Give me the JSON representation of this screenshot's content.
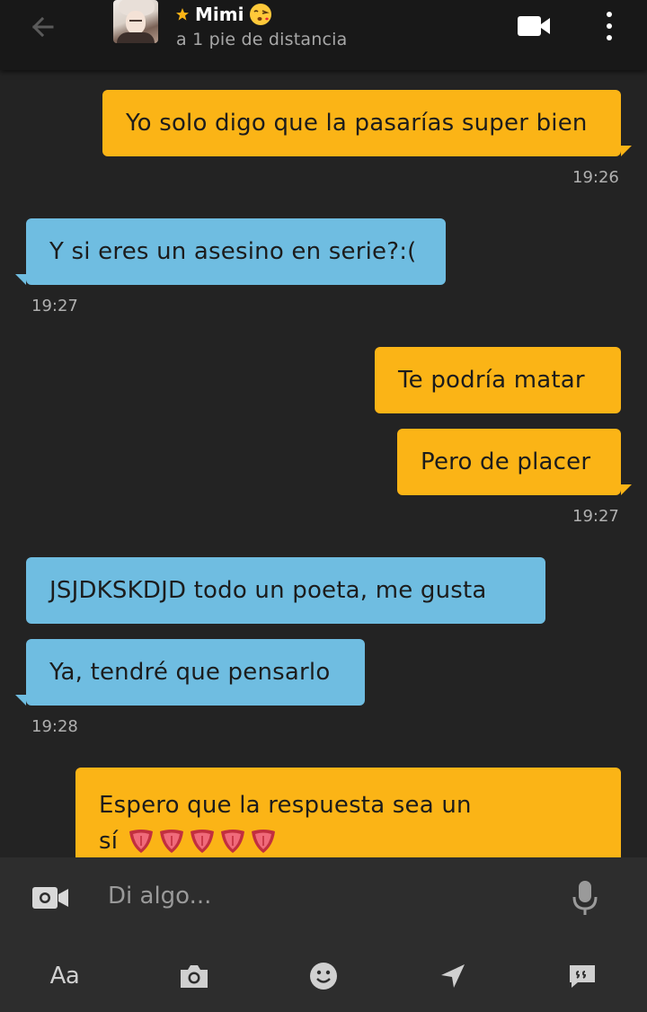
{
  "header": {
    "name": "Mimi",
    "distance": "a 1 pie de distancia",
    "icons": {
      "back": "back-arrow-icon",
      "favorite": "star-icon",
      "status_emoji": "kissing-face-emoji",
      "video": "video-camera-icon",
      "menu": "more-vertical-icon"
    },
    "colors": {
      "star": "#fbb416"
    }
  },
  "messages": [
    {
      "direction": "outgoing",
      "text": "Yo solo digo que la pasarías super bien"
    },
    {
      "direction": "outgoing",
      "time": "19:26"
    },
    {
      "direction": "incoming",
      "text": "Y si eres un asesino en serie?:("
    },
    {
      "direction": "incoming",
      "time": "19:27"
    },
    {
      "direction": "outgoing",
      "text": "Te podría matar"
    },
    {
      "direction": "outgoing",
      "text": "Pero de placer"
    },
    {
      "direction": "outgoing",
      "time": "19:27"
    },
    {
      "direction": "incoming",
      "text": "JSJDKSKDJD todo un poeta, me gusta"
    },
    {
      "direction": "incoming",
      "text": "Ya, tendré que pensarlo"
    },
    {
      "direction": "incoming",
      "time": "19:28"
    },
    {
      "direction": "outgoing",
      "text": "Espero que la respuesta sea un",
      "text_line2": "sí",
      "emojis": "tongue-emoji x5"
    }
  ],
  "input": {
    "placeholder": "Di algo...",
    "icons": {
      "left": "video-camera-icon",
      "right": "microphone-icon"
    }
  },
  "toolbar": {
    "text_label": "Aa",
    "icons": [
      "text-format-icon",
      "camera-icon",
      "smiley-icon",
      "location-arrow-icon",
      "saved-phrases-icon"
    ]
  },
  "colors": {
    "background": "#232323",
    "outgoing_bubble": "#fbb416",
    "incoming_bubble": "#6fbde1",
    "header": "#181818",
    "input_bar": "#2d2d2d"
  }
}
